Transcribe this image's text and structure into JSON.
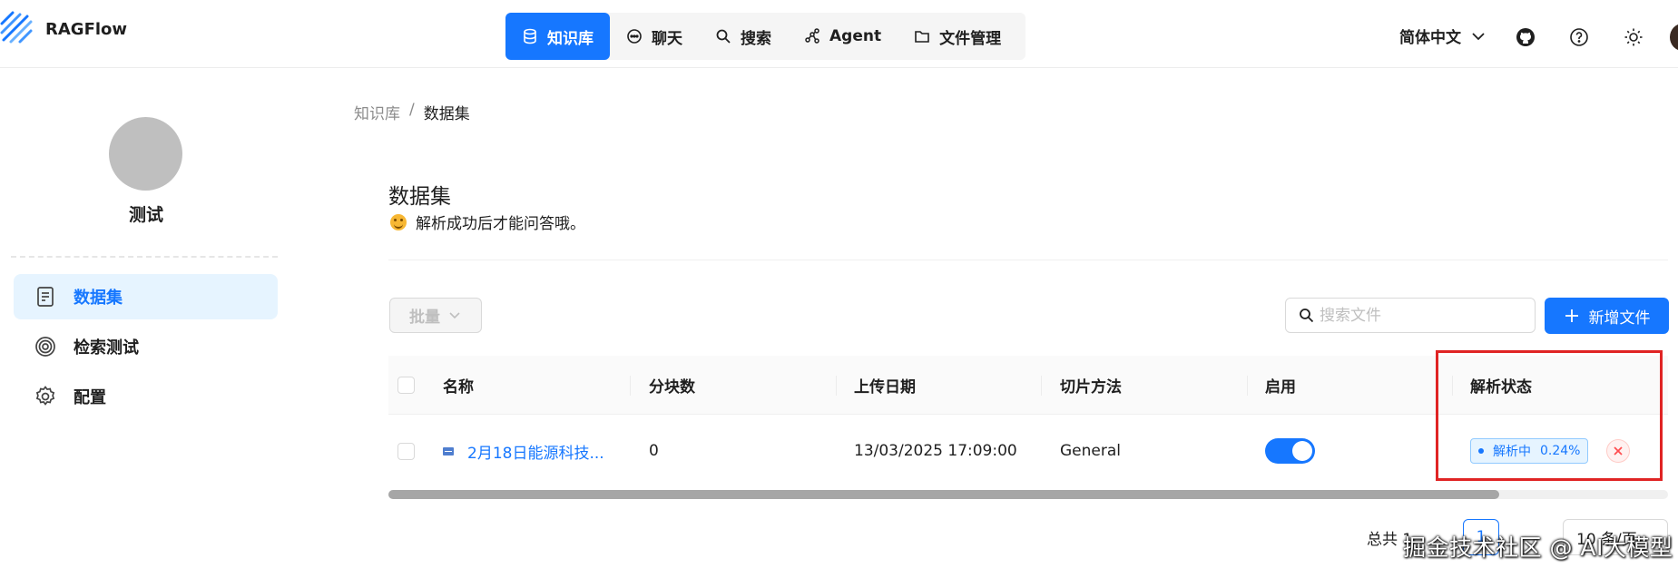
{
  "app": {
    "name": "RAGFlow"
  },
  "nav": {
    "items": [
      {
        "label": "知识库",
        "icon": "database-icon",
        "active": true
      },
      {
        "label": "聊天",
        "icon": "chat-icon"
      },
      {
        "label": "搜索",
        "icon": "search-icon"
      },
      {
        "label": "Agent",
        "icon": "graph-icon"
      },
      {
        "label": "文件管理",
        "icon": "folder-icon"
      }
    ]
  },
  "header": {
    "language": "简体中文"
  },
  "sidebar": {
    "kb_name": "测试",
    "items": [
      {
        "label": "数据集",
        "icon": "document-icon",
        "active": true
      },
      {
        "label": "检索测试",
        "icon": "target-icon"
      },
      {
        "label": "配置",
        "icon": "gear-icon"
      }
    ]
  },
  "breadcrumb": {
    "parent": "知识库",
    "separator": "/",
    "current": "数据集"
  },
  "main": {
    "title": "数据集",
    "tip": "解析成功后才能问答哦。",
    "batch_label": "批量",
    "search_placeholder": "搜索文件",
    "add_label": "新增文件"
  },
  "table": {
    "columns": [
      "名称",
      "分块数",
      "上传日期",
      "切片方法",
      "启用",
      "解析状态"
    ],
    "rows": [
      {
        "name": "2月18日能源科技...",
        "chunks": "0",
        "upload_date": "13/03/2025 17:09:00",
        "method": "General",
        "enabled": true,
        "status": "解析中",
        "progress": "0.24%"
      }
    ]
  },
  "pagination": {
    "total": "总共 1",
    "current_page": "1",
    "page_size": "10 条/页"
  },
  "watermark": "掘金技术社区 @ AI大模型",
  "colors": {
    "primary": "#1677ff",
    "highlight": "#e02424",
    "cancel": "#ff4d4f"
  }
}
